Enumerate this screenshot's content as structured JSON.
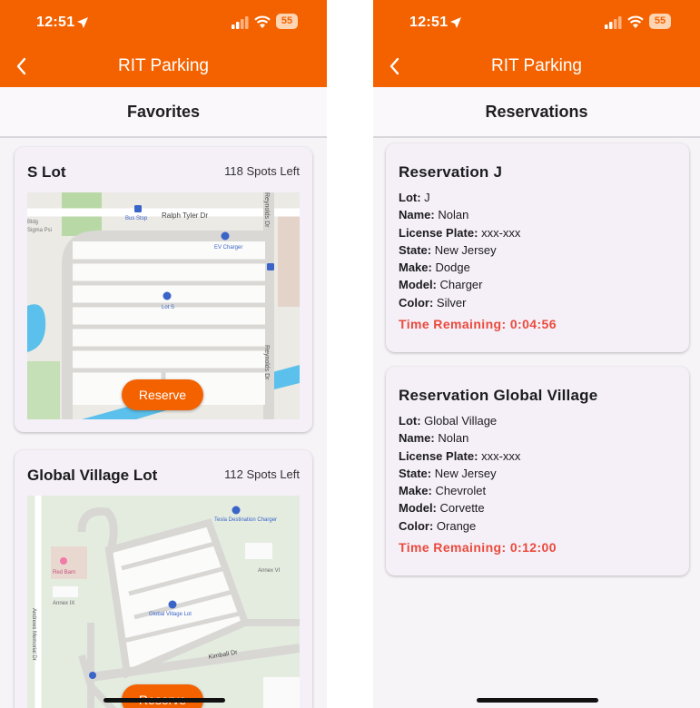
{
  "left": {
    "status": {
      "time": "12:51",
      "battery": "55"
    },
    "nav_title": "RIT Parking",
    "section_title": "Favorites",
    "lots": [
      {
        "name": "S Lot",
        "spots": "118 Spots Left",
        "reserve_label": "Reserve",
        "map_labels": {
          "street_top": "Ralph Tyler Dr",
          "street_right": "Reynolds Dr",
          "street_right2": "Reynolds Dr",
          "bus_stop": "Bus Stop",
          "ev": "EV Charger",
          "lot": "Lot S",
          "bldg": "Bldg",
          "bldg2": "Sigma Psi"
        }
      },
      {
        "name": "Global Village Lot",
        "spots": "112 Spots Left",
        "reserve_label": "Reserve",
        "map_labels": {
          "tesla": "Tesla Destination Charger",
          "red_barn": "Red Barn",
          "annex6": "Annex VI",
          "annex9": "Annex IX",
          "gv_lot": "Global Village Lot",
          "kimball": "Kimball Dr",
          "andrews": "Andrews Memorial Dr"
        }
      }
    ]
  },
  "right": {
    "status": {
      "time": "12:51",
      "battery": "55"
    },
    "nav_title": "RIT Parking",
    "section_title": "Reservations",
    "reservations": [
      {
        "title": "Reservation J",
        "lot_label": "Lot:",
        "lot": "J",
        "name_label": "Name:",
        "name": "Nolan",
        "plate_label": "License Plate:",
        "plate": "xxx-xxx",
        "state_label": "State:",
        "state": "New Jersey",
        "make_label": "Make:",
        "make": "Dodge",
        "model_label": "Model:",
        "model": "Charger",
        "color_label": "Color:",
        "color": "Silver",
        "time_remaining": "Time Remaining: 0:04:56"
      },
      {
        "title": "Reservation Global Village",
        "lot_label": "Lot:",
        "lot": "Global Village",
        "name_label": "Name:",
        "name": "Nolan",
        "plate_label": "License Plate:",
        "plate": "xxx-xxx",
        "state_label": "State:",
        "state": "New Jersey",
        "make_label": "Make:",
        "make": "Chevrolet",
        "model_label": "Model:",
        "model": "Corvette",
        "color_label": "Color:",
        "color": "Orange",
        "time_remaining": "Time Remaining: 0:12:00"
      }
    ]
  },
  "colors": {
    "brand": "#f46200",
    "timer": "#ea4a3c",
    "card": "#f5eff7"
  }
}
